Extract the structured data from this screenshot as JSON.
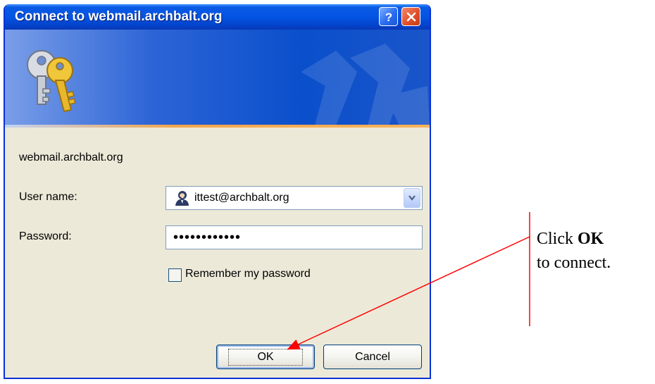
{
  "window": {
    "title": "Connect to webmail.archbalt.org",
    "help_button": "?",
    "close_button": "×"
  },
  "dialog": {
    "server_text": "webmail.archbalt.org",
    "username_label": "User name:",
    "username_value": "ittest@archbalt.org",
    "password_label": "Password:",
    "password_value": "••••••••••••",
    "remember_label": "Remember my password",
    "remember_checked": false,
    "ok_label": "OK",
    "cancel_label": "Cancel"
  },
  "annotation": {
    "line1_prefix": "Click ",
    "line1_bold": "OK",
    "line2": "to connect.",
    "color": "#ff0000"
  },
  "icons": [
    "keys-icon",
    "user-icon",
    "chevron-down-icon",
    "help-icon",
    "close-icon"
  ],
  "colors": {
    "titlebar": "#0454e3",
    "dialog_bg": "#ece9d8",
    "accent_orange": "#f3a54b"
  }
}
